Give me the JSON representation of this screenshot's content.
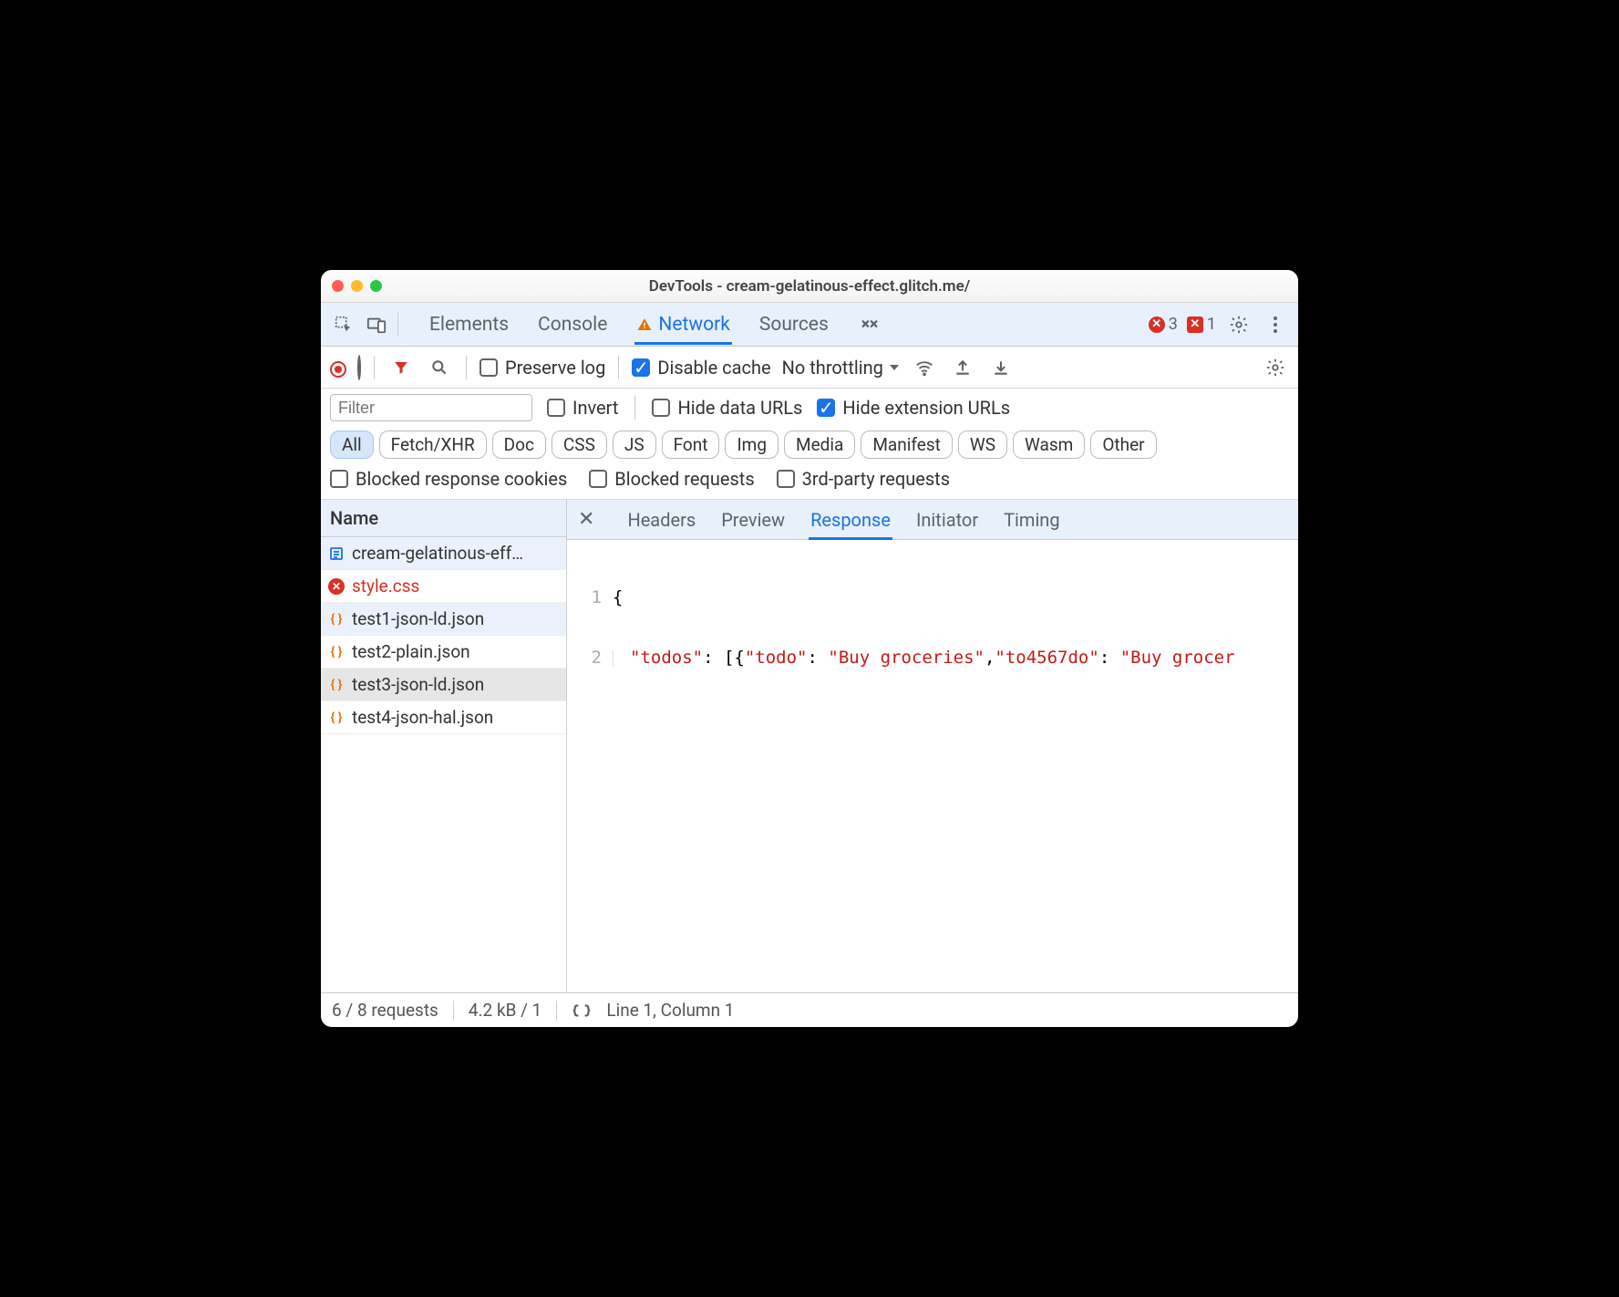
{
  "window": {
    "title": "DevTools - cream-gelatinous-effect.glitch.me/"
  },
  "tabs": {
    "items": [
      "Elements",
      "Console",
      "Network",
      "Sources"
    ],
    "active": "Network"
  },
  "badges": {
    "error_circle_count": "3",
    "error_square_count": "1"
  },
  "toolbar": {
    "preserve_log": "Preserve log",
    "disable_cache": "Disable cache",
    "throttling": "No throttling"
  },
  "filters": {
    "placeholder": "Filter",
    "invert": "Invert",
    "hide_data_urls": "Hide data URLs",
    "hide_ext_urls": "Hide extension URLs",
    "chips": [
      "All",
      "Fetch/XHR",
      "Doc",
      "CSS",
      "JS",
      "Font",
      "Img",
      "Media",
      "Manifest",
      "WS",
      "Wasm",
      "Other"
    ],
    "blocked_cookies": "Blocked response cookies",
    "blocked_requests": "Blocked requests",
    "third_party": "3rd-party requests"
  },
  "sidebar_header": "Name",
  "requests": [
    {
      "name": "cream-gelatinous-eff…",
      "icon": "doc",
      "error": false,
      "sel": true,
      "hl": false
    },
    {
      "name": "style.css",
      "icon": "err",
      "error": true,
      "sel": false,
      "hl": false
    },
    {
      "name": "test1-json-ld.json",
      "icon": "json",
      "error": false,
      "sel": true,
      "hl": false
    },
    {
      "name": "test2-plain.json",
      "icon": "json",
      "error": false,
      "sel": false,
      "hl": false
    },
    {
      "name": "test3-json-ld.json",
      "icon": "json",
      "error": false,
      "sel": false,
      "hl": true
    },
    {
      "name": "test4-json-hal.json",
      "icon": "json",
      "error": false,
      "sel": false,
      "hl": false
    }
  ],
  "detail_tabs": {
    "items": [
      "Headers",
      "Preview",
      "Response",
      "Initiator",
      "Timing"
    ],
    "active": "Response"
  },
  "code": {
    "line1_num": "1",
    "line1_text": "{",
    "line2_num": "2",
    "line2_key1": "\"todos\"",
    "line2_p1": ": [{",
    "line2_key2": "\"todo\"",
    "line2_p2": ": ",
    "line2_val1": "\"Buy groceries\"",
    "line2_p3": ",",
    "line2_key3": "\"to4567do\"",
    "line2_p4": ": ",
    "line2_val2": "\"Buy grocer"
  },
  "status": {
    "requests": "6 / 8 requests",
    "size": "4.2 kB / 1",
    "cursor": "Line 1, Column 1"
  }
}
